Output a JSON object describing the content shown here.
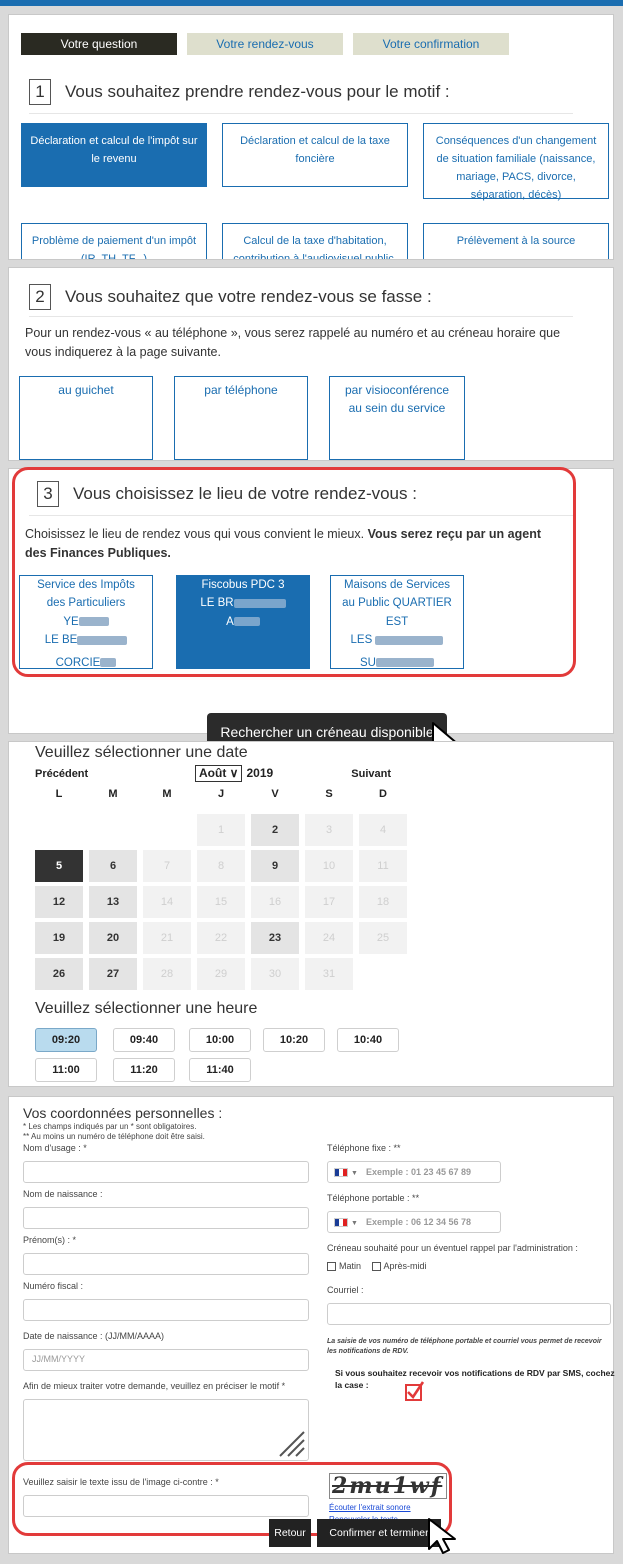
{
  "steps": [
    "Votre question",
    "Votre rendez-vous",
    "Votre confirmation"
  ],
  "section1": {
    "number": "1",
    "title": "Vous souhaitez prendre rendez-vous pour le motif :",
    "motifs": [
      "Déclaration et calcul de l'impôt sur le revenu",
      "Déclaration et calcul de la taxe foncière",
      "Conséquences d'un changement de situation familiale (naissance, mariage, PACS, divorce, séparation, décès)",
      "Problème de paiement d'un impôt (IR, TH, TF...)",
      "Calcul de la taxe d'habitation, contribution à l'audiovisuel public,",
      "Prélèvement à la source"
    ]
  },
  "section2": {
    "number": "2",
    "title": "Vous souhaitez que votre rendez-vous se fasse :",
    "text": "Pour un rendez-vous « au téléphone », vous serez rappelé au numéro et au créneau horaire que vous indiquerez à la page suivante.",
    "types": [
      "au guichet",
      "par téléphone",
      "par visioconférence au sein du service"
    ]
  },
  "section3": {
    "number": "3",
    "title": "Vous choisissez le lieu de votre rendez-vous :",
    "text": "Choisissez le lieu de rendez vous qui vous convient le mieux.",
    "text_bold": "Vous serez reçu par un agent des Finances Publiques.",
    "lieux": [
      {
        "line1": "Service des Impôts",
        "line2": "des Particuliers",
        "line3": "YE",
        "line4": "LE BE",
        "line5": "CORCIE"
      },
      {
        "line1": "Fiscobus PDC 3",
        "line2": "LE BR",
        "line3": "A"
      },
      {
        "line1": "Maisons de Services",
        "line2": "au Public QUARTIER",
        "line3": "EST",
        "line4": "LES",
        "line5": "SU"
      }
    ],
    "search_button": "Rechercher un créneau disponible"
  },
  "calendar": {
    "title": "Veuillez sélectionner une date",
    "prev": "Précédent",
    "next": "Suivant",
    "month": "Août",
    "year": "2019",
    "weekdays": [
      "L",
      "M",
      "M",
      "J",
      "V",
      "S",
      "D"
    ],
    "weeks": [
      [
        null,
        null,
        null,
        "1",
        "2",
        "3",
        "4"
      ],
      [
        "5",
        "6",
        "7",
        "8",
        "9",
        "10",
        "11"
      ],
      [
        "12",
        "13",
        "14",
        "15",
        "16",
        "17",
        "18"
      ],
      [
        "19",
        "20",
        "21",
        "22",
        "23",
        "24",
        "25"
      ],
      [
        "26",
        "27",
        "28",
        "29",
        "30",
        "31",
        null
      ]
    ],
    "available": [
      "2",
      "5",
      "6",
      "9",
      "12",
      "13",
      "19",
      "20",
      "23",
      "26",
      "27"
    ],
    "selected": "5",
    "time_title": "Veuillez sélectionner une heure",
    "times": [
      "09:20",
      "09:40",
      "10:00",
      "10:20",
      "10:40",
      "11:00",
      "11:20",
      "11:40"
    ],
    "selected_time": "09:20"
  },
  "form": {
    "title": "Vos coordonnées personnelles :",
    "note1": "* Les champs indiqués par un * sont obligatoires.",
    "note2": "** Au moins un numéro de téléphone doit être saisi.",
    "nom_usage": "Nom d'usage : *",
    "nom_naissance": "Nom de naissance :",
    "prenoms": "Prénom(s) : *",
    "numero_fiscal": "Numéro fiscal :",
    "date_naissance": "Date de naissance : (JJ/MM/AAAA)",
    "date_placeholder": "JJ/MM/YYYY",
    "motif": "Afin de mieux traiter votre demande, veuillez en préciser le motif *",
    "tel_fixe": "Téléphone fixe : **",
    "tel_fixe_placeholder": "Exemple : 01 23 45 67 89",
    "tel_portable": "Téléphone portable : **",
    "tel_portable_placeholder": "Exemple : 06 12 34 56 78",
    "creneau": "Créneau souhaité pour un éventuel rappel par l'administration :",
    "matin": "Matin",
    "apres_midi": "Après-midi",
    "courriel": "Courriel :",
    "info": "La saisie de vos numéro de téléphone portable et courriel vous permet de recevoir les notifications de RDV.",
    "sms": "Si vous souhaitez recevoir vos notifications de RDV par SMS, cochez la case :",
    "captcha_label": "Veuillez saisir le texte issu de l'image ci-contre : *",
    "captcha_text": "2mu1wf",
    "captcha_audio": "Écouter l'extrait sonore",
    "captcha_renew": "Renouveler le texte",
    "retour": "Retour",
    "confirmer": "Confirmer et terminer"
  },
  "colors": {
    "primary": "#1a6db0",
    "dark": "#2a2a22",
    "highlight": "#e23a3a"
  }
}
